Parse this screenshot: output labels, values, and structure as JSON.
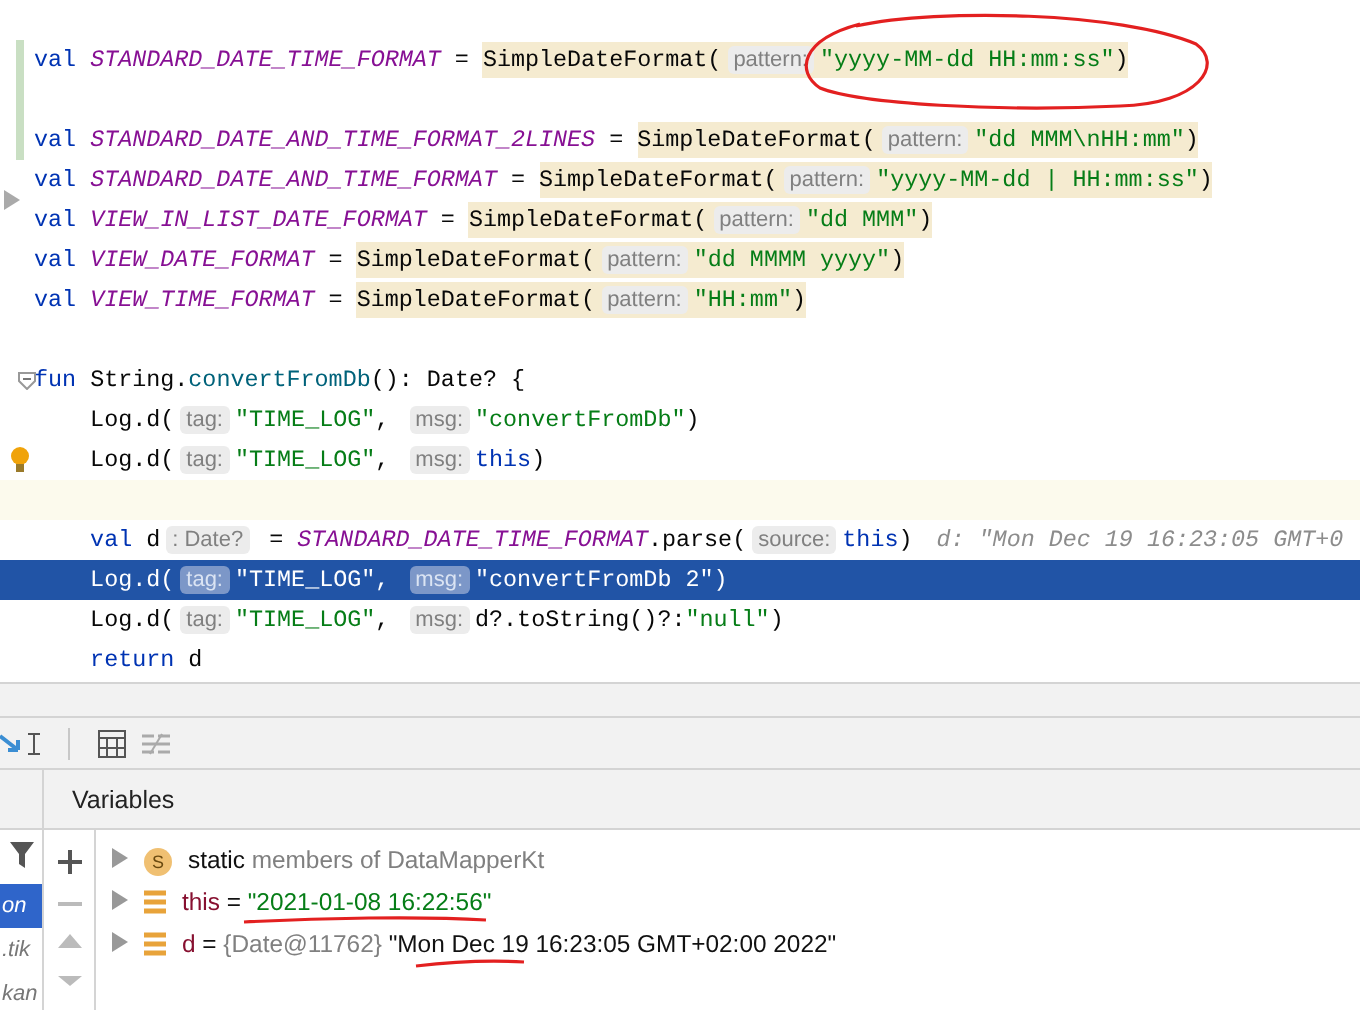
{
  "editor": {
    "lines": [
      {
        "kind": "code",
        "changed": true,
        "tokens": [
          {
            "kind": "kw",
            "text": "val "
          },
          {
            "kind": "const",
            "text": "STANDARD_DATE_TIME_FORMAT"
          },
          {
            "kind": "plain",
            "text": " = "
          }
        ],
        "call": [
          {
            "kind": "plain",
            "text": "SimpleDateFormat("
          },
          {
            "kind": "hint",
            "text": "pattern:"
          },
          {
            "kind": "str",
            "text": "\"yyyy-MM-dd HH:mm:ss\""
          },
          {
            "kind": "plain",
            "text": ")"
          }
        ]
      },
      {
        "kind": "blank",
        "changed": true
      },
      {
        "kind": "code",
        "changed": true,
        "tokens": [
          {
            "kind": "kw",
            "text": "val "
          },
          {
            "kind": "const",
            "text": "STANDARD_DATE_AND_TIME_FORMAT_2LINES"
          },
          {
            "kind": "plain",
            "text": " = "
          }
        ],
        "call": [
          {
            "kind": "plain",
            "text": "SimpleDateFormat("
          },
          {
            "kind": "hint",
            "text": "pattern:"
          },
          {
            "kind": "str",
            "text": "\"dd MMM\\nHH:mm\""
          },
          {
            "kind": "plain",
            "text": ")"
          }
        ]
      },
      {
        "kind": "code",
        "changed": false,
        "tokens": [
          {
            "kind": "kw",
            "text": "val "
          },
          {
            "kind": "const",
            "text": "STANDARD_DATE_AND_TIME_FORMAT"
          },
          {
            "kind": "plain",
            "text": " = "
          }
        ],
        "call": [
          {
            "kind": "plain",
            "text": "SimpleDateFormat("
          },
          {
            "kind": "hint",
            "text": "pattern:"
          },
          {
            "kind": "str",
            "text": "\"yyyy-MM-dd | HH:mm:ss\""
          },
          {
            "kind": "plain",
            "text": ")"
          }
        ]
      },
      {
        "kind": "code",
        "changed": false,
        "tokens": [
          {
            "kind": "kw",
            "text": "val "
          },
          {
            "kind": "const",
            "text": "VIEW_IN_LIST_DATE_FORMAT"
          },
          {
            "kind": "plain",
            "text": " = "
          }
        ],
        "call": [
          {
            "kind": "plain",
            "text": "SimpleDateFormat("
          },
          {
            "kind": "hint",
            "text": "pattern:"
          },
          {
            "kind": "str",
            "text": "\"dd MMM\""
          },
          {
            "kind": "plain",
            "text": ")"
          }
        ]
      },
      {
        "kind": "code",
        "changed": false,
        "tokens": [
          {
            "kind": "kw",
            "text": "val "
          },
          {
            "kind": "const",
            "text": "VIEW_DATE_FORMAT"
          },
          {
            "kind": "plain",
            "text": " = "
          }
        ],
        "call": [
          {
            "kind": "plain",
            "text": "SimpleDateFormat("
          },
          {
            "kind": "hint",
            "text": "pattern:"
          },
          {
            "kind": "str",
            "text": "\"dd MMMM yyyy\""
          },
          {
            "kind": "plain",
            "text": ")"
          }
        ]
      },
      {
        "kind": "code",
        "changed": false,
        "tokens": [
          {
            "kind": "kw",
            "text": "val "
          },
          {
            "kind": "const",
            "text": "VIEW_TIME_FORMAT"
          },
          {
            "kind": "plain",
            "text": " = "
          }
        ],
        "call": [
          {
            "kind": "plain",
            "text": "SimpleDateFormat("
          },
          {
            "kind": "hint",
            "text": "pattern:"
          },
          {
            "kind": "str",
            "text": "\"HH:mm\""
          },
          {
            "kind": "plain",
            "text": ")"
          }
        ]
      },
      {
        "kind": "blank",
        "changed": false
      },
      {
        "kind": "code",
        "changed": false,
        "tokens": [
          {
            "kind": "kw",
            "text": "fun "
          },
          {
            "kind": "plain",
            "text": "String."
          },
          {
            "kind": "fn",
            "text": "convertFromDb"
          },
          {
            "kind": "plain",
            "text": "(): Date? {"
          }
        ]
      },
      {
        "kind": "code",
        "changed": false,
        "tokens": [
          {
            "kind": "plain",
            "text": "    Log.d("
          },
          {
            "kind": "hint",
            "text": "tag:"
          },
          {
            "kind": "str",
            "text": "\"TIME_LOG\""
          },
          {
            "kind": "plain",
            "text": ", "
          },
          {
            "kind": "hint",
            "text": "msg:"
          },
          {
            "kind": "str",
            "text": "\"convertFromDb\""
          },
          {
            "kind": "plain",
            "text": ")"
          }
        ]
      },
      {
        "kind": "code",
        "changed": false,
        "tokens": [
          {
            "kind": "plain",
            "text": "    Log.d("
          },
          {
            "kind": "hint",
            "text": "tag:"
          },
          {
            "kind": "str",
            "text": "\"TIME_LOG\""
          },
          {
            "kind": "plain",
            "text": ", "
          },
          {
            "kind": "hint",
            "text": "msg:"
          },
          {
            "kind": "kw",
            "text": "this"
          },
          {
            "kind": "plain",
            "text": ")"
          }
        ]
      },
      {
        "kind": "caret",
        "changed": false
      },
      {
        "kind": "code",
        "changed": false,
        "tokens": [
          {
            "kind": "kw",
            "text": "    val "
          },
          {
            "kind": "plain",
            "text": "d"
          },
          {
            "kind": "hint",
            "text": ": Date?"
          },
          {
            "kind": "plain",
            "text": " = "
          },
          {
            "kind": "const",
            "text": "STANDARD_DATE_TIME_FORMAT"
          },
          {
            "kind": "plain",
            "text": ".parse("
          },
          {
            "kind": "hint",
            "text": "source:"
          },
          {
            "kind": "kw",
            "text": "this"
          },
          {
            "kind": "plain",
            "text": ")"
          },
          {
            "kind": "inline",
            "text": "d: \"Mon Dec 19 16:23:05 GMT+0"
          }
        ]
      },
      {
        "kind": "execution",
        "changed": false,
        "tokens": [
          {
            "kind": "plain",
            "text": "    Log.d("
          },
          {
            "kind": "hint",
            "text": "tag:"
          },
          {
            "kind": "str",
            "text": "\"TIME_LOG\""
          },
          {
            "kind": "plain",
            "text": ", "
          },
          {
            "kind": "hint",
            "text": "msg:"
          },
          {
            "kind": "str",
            "text": "\"convertFromDb 2\""
          },
          {
            "kind": "plain",
            "text": ")"
          }
        ]
      },
      {
        "kind": "code",
        "changed": false,
        "tokens": [
          {
            "kind": "plain",
            "text": "    Log.d("
          },
          {
            "kind": "hint",
            "text": "tag:"
          },
          {
            "kind": "str",
            "text": "\"TIME_LOG\""
          },
          {
            "kind": "plain",
            "text": ", "
          },
          {
            "kind": "hint",
            "text": "msg:"
          },
          {
            "kind": "plain",
            "text": "d?.toString()?:"
          },
          {
            "kind": "str",
            "text": "\"null\""
          },
          {
            "kind": "plain",
            "text": ")"
          }
        ]
      },
      {
        "kind": "code",
        "changed": false,
        "tokens": [
          {
            "kind": "kw",
            "text": "    return "
          },
          {
            "kind": "plain",
            "text": "d"
          }
        ]
      }
    ]
  },
  "debugger": {
    "frames": [
      {
        "text": "on",
        "selected": true
      },
      {
        "text": ".tik",
        "selected": false
      },
      {
        "text": "kan",
        "selected": false
      }
    ],
    "variables_title": "Variables",
    "variables": [
      {
        "badge": "S",
        "parts": [
          {
            "kind": "bold",
            "text": "static"
          },
          {
            "kind": "muted",
            "text": " members of DataMapperKt"
          }
        ]
      },
      {
        "parts": [
          {
            "kind": "name",
            "text": "this"
          },
          {
            "kind": "plain",
            "text": " = "
          },
          {
            "kind": "str",
            "text": "\"2021-01-08 16:22:56\""
          }
        ]
      },
      {
        "parts": [
          {
            "kind": "name",
            "text": "d"
          },
          {
            "kind": "plain",
            "text": " = "
          },
          {
            "kind": "muted",
            "text": "{Date@11762} "
          },
          {
            "kind": "plain",
            "text": "\"Mon Dec 19 16:23:05 GMT+02:00 2022\""
          }
        ]
      }
    ]
  }
}
